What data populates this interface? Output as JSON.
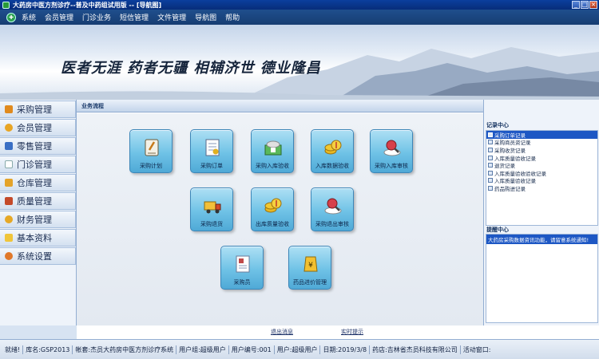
{
  "window": {
    "title": "大药房中医方剂诊疗--普及中药组试用版 -- [导航图]"
  },
  "menu": [
    "系统",
    "会员管理",
    "门诊业务",
    "短信管理",
    "文件管理",
    "导航图",
    "帮助"
  ],
  "banner": {
    "slogan": "医者无涯  药者无疆  相辅济世  德业隆昌"
  },
  "sidebar": {
    "items": [
      {
        "label": "采购管理",
        "icon": "leaf-icon",
        "color": "#e08a1e"
      },
      {
        "label": "会员管理",
        "icon": "member-icon",
        "color": "#e8a524"
      },
      {
        "label": "零售管理",
        "icon": "cart-icon",
        "color": "#3a6fc4"
      },
      {
        "label": "门诊管理",
        "icon": "clinic-icon",
        "color": "#ffffff"
      },
      {
        "label": "仓库管理",
        "icon": "warehouse-icon",
        "color": "#e4a32a"
      },
      {
        "label": "质量管理",
        "icon": "quality-icon",
        "color": "#c44a2a"
      },
      {
        "label": "财务管理",
        "icon": "finance-icon",
        "color": "#e6a826"
      },
      {
        "label": "基本资料",
        "icon": "folder-icon",
        "color": "#f0c53a"
      },
      {
        "label": "系统设置",
        "icon": "settings-icon",
        "color": "#e0782a"
      }
    ]
  },
  "main": {
    "header": "业务流程",
    "tiles": [
      {
        "label": "采购计划",
        "icon": "plan-icon"
      },
      {
        "label": "采购订单",
        "icon": "order-icon"
      },
      {
        "label": "采购入库验收",
        "icon": "receipt-icon"
      },
      {
        "label": "入库数据验收",
        "icon": "coins-icon"
      },
      {
        "label": "采购入库审核",
        "icon": "magnifier-icon"
      },
      {
        "label": "采购退货",
        "icon": "truck-icon"
      },
      {
        "label": "出库质量验收",
        "icon": "coins-icon"
      },
      {
        "label": "采购退出审核",
        "icon": "magnifier-icon"
      },
      {
        "label": "采购员",
        "icon": "card-icon"
      },
      {
        "label": "药品进价管理",
        "icon": "price-icon"
      }
    ]
  },
  "records": {
    "title": "记录中心",
    "items": [
      "采购订单记录",
      "采购商员资记录",
      "采购收货记录",
      "入库质量验收记录",
      "退货记录",
      "入库质量验收验收记录",
      "入库质量验收记录",
      "药品购进记录"
    ],
    "selected_index": 0
  },
  "notices": {
    "title": "提醒中心",
    "items": [
      "大药房采购数据资讯功能，请留意系统通知!"
    ]
  },
  "footer": {
    "links": [
      "退出消息",
      "实时提示"
    ]
  },
  "status": {
    "items": [
      "就绪!",
      "库名:GSP2013",
      "帐套:杰员大药房中医方剂诊疗系统",
      "用户组:超级用户",
      "用户编号:001",
      "用户:超级用户",
      "日期:2019/3/8",
      "药店:吉林省杰员科技有限公司",
      "活动窗口:"
    ]
  }
}
